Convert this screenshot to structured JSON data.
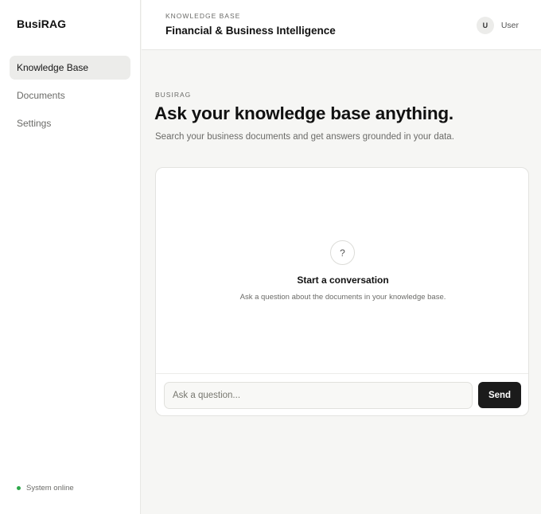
{
  "brand": "BusiRAG",
  "sidebar": {
    "items": [
      {
        "label": "Knowledge Base",
        "active": true
      },
      {
        "label": "Documents",
        "active": false
      },
      {
        "label": "Settings",
        "active": false
      }
    ],
    "status": {
      "label": "System online",
      "color": "#2ea84a"
    }
  },
  "header": {
    "eyebrow": "KNOWLEDGE BASE",
    "title": "Financial & Business Intelligence",
    "user": {
      "initial": "U",
      "name": "User"
    }
  },
  "main": {
    "eyebrow": "BUSIRAG",
    "title": "Ask your knowledge base anything.",
    "subtitle": "Search your business documents and get answers grounded in your data.",
    "empty_state": {
      "icon": "question-icon",
      "icon_glyph": "?",
      "title": "Start a conversation",
      "description": "Ask a question about the documents in your knowledge base."
    },
    "composer": {
      "placeholder": "Ask a question...",
      "value": "",
      "send_label": "Send"
    }
  },
  "colors": {
    "accent": "#1b1b1b",
    "status_online": "#2ea84a",
    "background": "#f6f6f4"
  }
}
